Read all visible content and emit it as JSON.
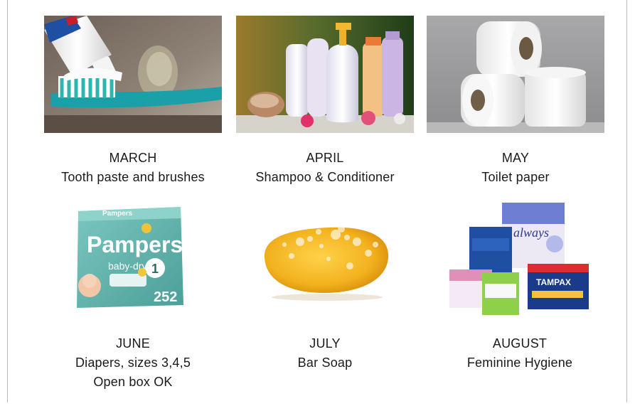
{
  "items": [
    {
      "month": "MARCH",
      "lines": [
        "Tooth paste and brushes"
      ],
      "image": "toothbrush-with-toothpaste-photo"
    },
    {
      "month": "APRIL",
      "lines": [
        "Shampoo & Conditioner"
      ],
      "image": "shampoo-bottles-photo"
    },
    {
      "month": "MAY",
      "lines": [
        "Toilet paper"
      ],
      "image": "toilet-paper-rolls-photo"
    },
    {
      "month": "JUNE",
      "lines": [
        "Diapers, sizes 3,4,5",
        "Open box OK"
      ],
      "image": "pampers-diaper-box-photo"
    },
    {
      "month": "JULY",
      "lines": [
        "Bar Soap"
      ],
      "image": "bar-soap-photo"
    },
    {
      "month": "AUGUST",
      "lines": [
        "Feminine Hygiene"
      ],
      "image": "feminine-hygiene-products-photo"
    }
  ],
  "product_text": {
    "pampers_logo": "Pampers",
    "pampers_sub": "baby-dry",
    "pampers_count": "252",
    "pampers_size": "1",
    "always_logo": "always",
    "tampax_logo": "TAMPAX"
  },
  "colors": {
    "frame_border": "#bdbdbd",
    "text": "#1a1a1a",
    "pampers_teal": "#5fb3ad",
    "soap_yellow": "#f2b21e"
  }
}
